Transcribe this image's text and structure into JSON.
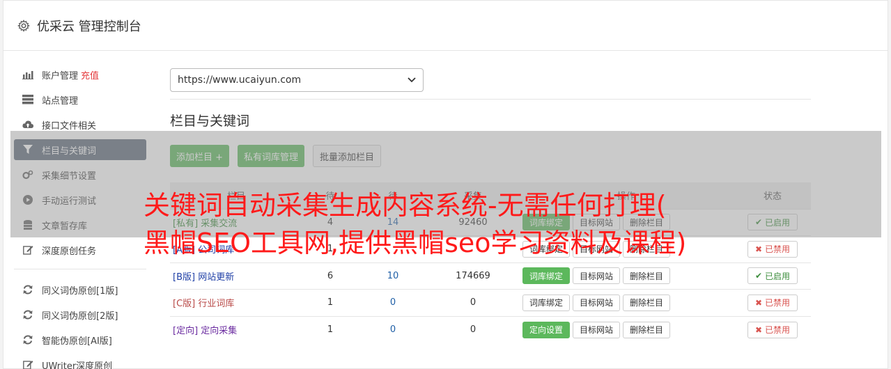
{
  "header": {
    "title": "优采云 管理控制台",
    "icon": "gear-icon"
  },
  "sidebar": {
    "items": [
      {
        "label": "账户管理",
        "extra": "充值",
        "icon": "bar-chart-icon"
      },
      {
        "label": "站点管理",
        "icon": "server-icon"
      },
      {
        "label": "接口文件相关",
        "icon": "cloud-upload-icon"
      },
      {
        "label": "栏目与关键词",
        "icon": "filter-icon",
        "active": true
      },
      {
        "label": "采集细节设置",
        "icon": "cogs-icon"
      },
      {
        "label": "手动运行测试",
        "icon": "play-circle-icon"
      },
      {
        "label": "文章暂存库",
        "icon": "database-icon"
      },
      {
        "label": "深度原创任务",
        "icon": "edit-icon"
      }
    ],
    "items2": [
      {
        "label": "同义词伪原创[1版]",
        "icon": "refresh-icon"
      },
      {
        "label": "同义词伪原创[2版]",
        "icon": "refresh-icon"
      },
      {
        "label": "智能伪原创[AI版]",
        "icon": "refresh-icon"
      },
      {
        "label": "UWriter深度原创",
        "icon": "edit-icon"
      }
    ]
  },
  "main": {
    "site_select": "https://www.ucaiyun.com",
    "section_title": "栏目与关键词",
    "buttons": {
      "add": "添加栏目 +",
      "private": "私有词库管理",
      "batch": "批量添加栏目"
    },
    "table": {
      "headers": [
        "栏目",
        "待",
        "待",
        "采集",
        "操作",
        "状态"
      ],
      "rows": [
        {
          "tag": "[私有]",
          "name": "采集交流",
          "n1": "4",
          "n2": "14",
          "n3": "92460",
          "op1": "词库绑定",
          "op1_green": true,
          "op2": "目标网站",
          "op3": "删除栏目",
          "status": "已启用",
          "on": true,
          "color": "green"
        },
        {
          "tag": "[A版]",
          "name": "公司词库",
          "n1": "1",
          "n2": "",
          "n3": "",
          "op1": "词库绑定",
          "op1_green": false,
          "op2": "目标网站",
          "op3": "删除栏目",
          "status": "已禁用",
          "on": false,
          "color": "blue"
        },
        {
          "tag": "[B版]",
          "name": "网站更新",
          "n1": "6",
          "n2": "10",
          "n3": "174669",
          "op1": "词库绑定",
          "op1_green": true,
          "op2": "目标网站",
          "op3": "删除栏目",
          "status": "已启用",
          "on": true,
          "color": "blue"
        },
        {
          "tag": "[C版]",
          "name": "行业词库",
          "n1": "1",
          "n2": "0",
          "n3": "0",
          "op1": "词库绑定",
          "op1_green": false,
          "op2": "目标网站",
          "op3": "删除栏目",
          "status": "已禁用",
          "on": false,
          "color": "red"
        },
        {
          "tag": "[定向]",
          "name": "定向采集",
          "n1": "1",
          "n2": "0",
          "n3": "0",
          "op1": "定向设置",
          "op1_green": true,
          "op2": "目标网站",
          "op3": "删除栏目",
          "status": "已禁用",
          "on": false,
          "color": "purple"
        }
      ]
    }
  },
  "overlay": {
    "line1": "关键词自动采集生成内容系统-无需任何打理(",
    "line2": "黑帽SEO工具网,提供黑帽seo学习资料及课程)"
  },
  "colors": {
    "accent_green": "#5cb85c",
    "active_nav": "#5e6b7a",
    "overlay_red": "#ff1a1a",
    "recharge_red": "#e4393c"
  }
}
